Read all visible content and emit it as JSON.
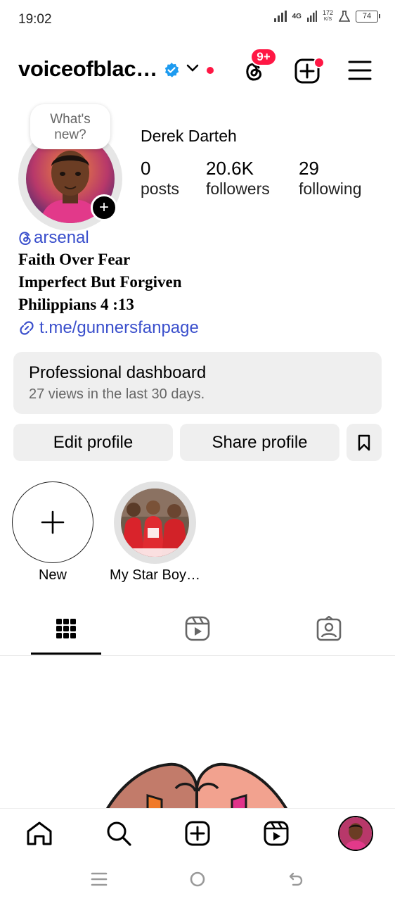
{
  "status_bar": {
    "time": "19:02",
    "network": "4G",
    "speed_value": "172",
    "speed_unit": "K/S",
    "battery": "74"
  },
  "header": {
    "username": "voiceofblac…",
    "notification_badge": "9+"
  },
  "profile": {
    "whats_new": "What's new?",
    "full_name": "Derek Darteh",
    "stats": [
      {
        "value": "0",
        "label": "posts"
      },
      {
        "value": "20.6K",
        "label": "followers"
      },
      {
        "value": "29",
        "label": "following"
      }
    ],
    "threads_handle": "arsenal",
    "bio_lines": [
      "Faith Over Fear",
      "Imperfect But Forgiven",
      "Philippians 4 :13"
    ],
    "link": "t.me/gunnersfanpage"
  },
  "dashboard": {
    "title": "Professional dashboard",
    "subtitle": "27 views in the last 30 days."
  },
  "buttons": {
    "edit": "Edit profile",
    "share": "Share profile"
  },
  "highlights": [
    {
      "label": "New"
    },
    {
      "label": "My Star Boy…"
    }
  ],
  "tabs": [
    "grid-icon",
    "reels-icon",
    "tagged-icon"
  ],
  "bottom_nav": [
    "home-icon",
    "search-icon",
    "create-icon",
    "reels-icon",
    "profile-avatar"
  ],
  "colors": {
    "accent_red": "#ff1744",
    "link_blue": "#3a4fcc",
    "verified_blue": "#1d9bf0",
    "card_bg": "#efefef"
  }
}
